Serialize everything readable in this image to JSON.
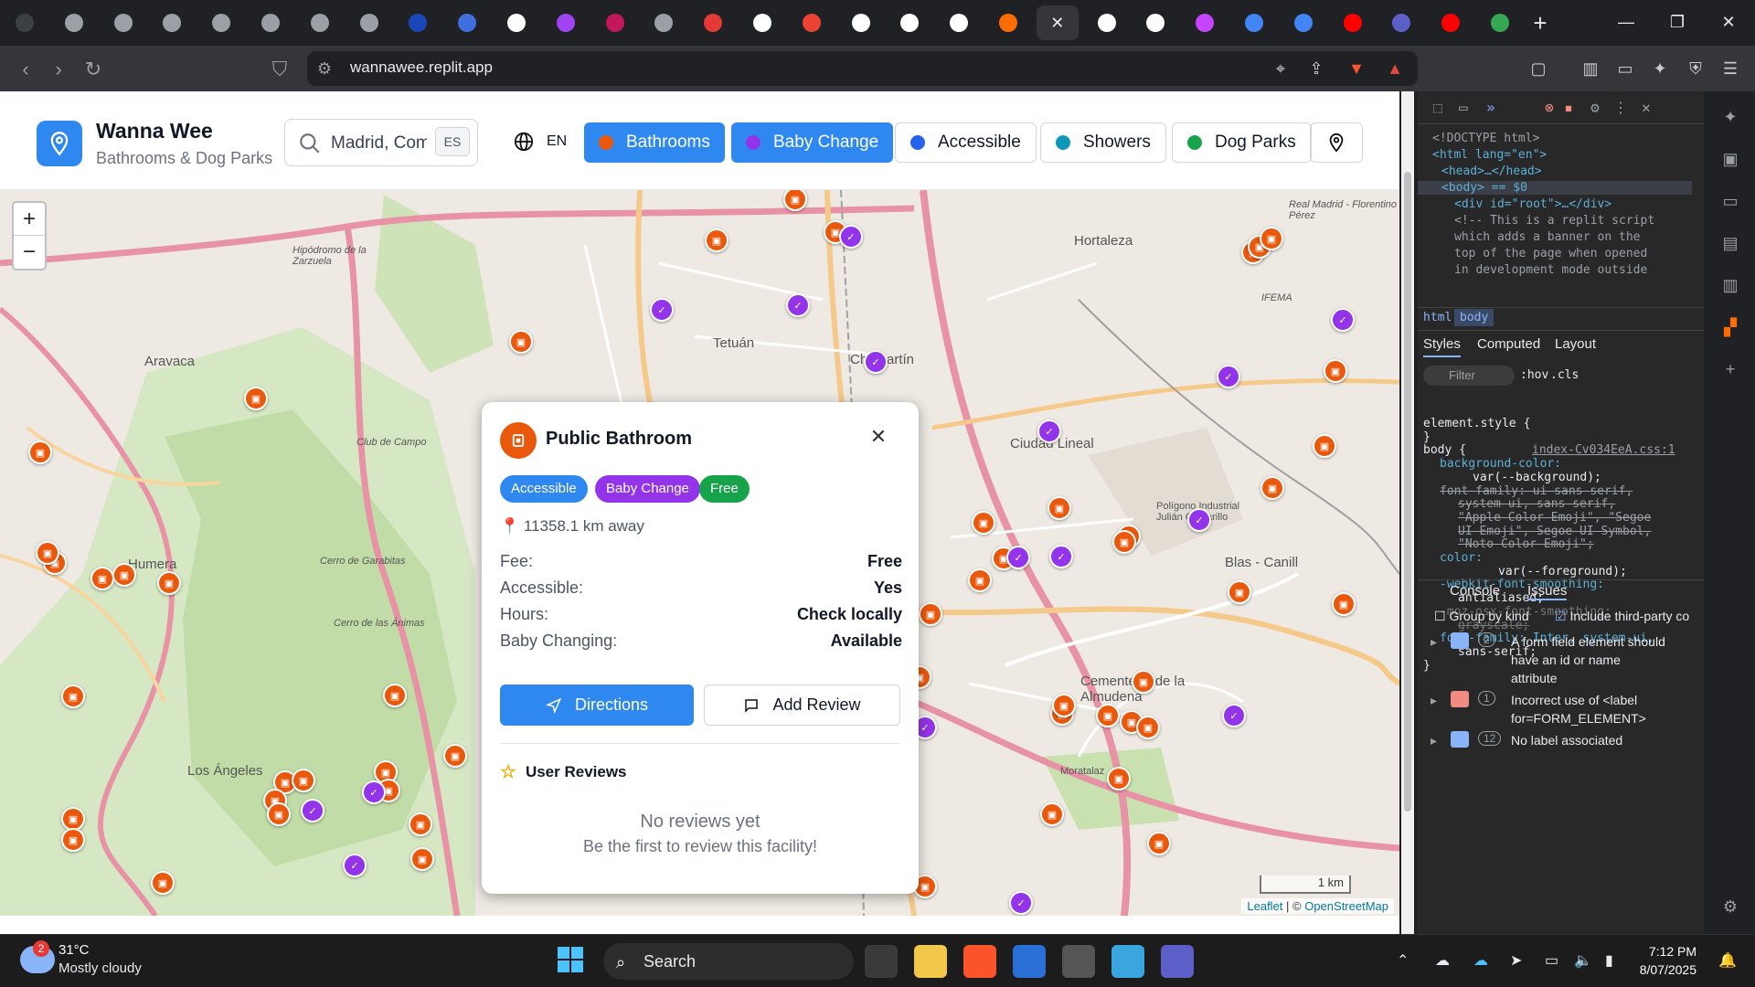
{
  "browser": {
    "url": "wannawee.replit.app",
    "tabs_colors": [
      "#3c4043",
      "#9aa0a6",
      "#9aa0a6",
      "#9aa0a6",
      "#9aa0a6",
      "#9aa0a6",
      "#9aa0a6",
      "#9aa0a6",
      "#1a47b8",
      "#3f6fdc",
      "#ffffff",
      "#a142f4",
      "#c2185b",
      "#9aa0a6",
      "#e53935",
      "#ffffff",
      "#ea4335",
      "#ffffff",
      "#ffffff",
      "#ffffff",
      "#ff6d00",
      "#ffffff",
      "#ffffff",
      "#ffffff",
      "#c544ff",
      "#4285f4",
      "#4285f4",
      "#ff0000",
      "#5b5fc7",
      "#ff0000",
      "#34a853"
    ]
  },
  "app": {
    "name": "Wanna Wee",
    "subtitle": "Bathrooms & Dog Parks",
    "search_value": "Madrid, Comunidad de Madrid",
    "lang_toggle": "ES",
    "lang_current": "EN",
    "filters": [
      {
        "label": "Bathrooms",
        "dot": "#ea580c",
        "active": true
      },
      {
        "label": "Baby Change",
        "dot": "#9333ea",
        "active": true
      },
      {
        "label": "Accessible",
        "dot": "#2563eb",
        "active": false
      },
      {
        "label": "Showers",
        "dot": "#0e98b8",
        "active": false
      },
      {
        "label": "Dog Parks",
        "dot": "#16a34a",
        "active": false
      }
    ]
  },
  "map": {
    "zoom_in": "+",
    "zoom_out": "−",
    "scale": "1 km",
    "attribution_leaflet": "Leaflet",
    "attribution_sep": " | © ",
    "attribution_osm": "OpenStreetMap",
    "labels": [
      "Tetuán",
      "Chamartín",
      "Hortaleza",
      "Ciudad Lineal",
      "Aravaca",
      "Humera",
      "Los Ángeles",
      "Blas - Canill",
      "Hipódromo de la Zarzuela",
      "Club de Campo",
      "Polígono Industrial Julián Camarillo",
      "Cementerio de la Almudena",
      "Moratalaz",
      "Real Madrid - Florentino Pérez",
      "IFEMA",
      "Cerro de Garabitas",
      "Cerro de las Ánimas"
    ]
  },
  "popup": {
    "title": "Public Bathroom",
    "badges": [
      {
        "label": "Accessible",
        "color": "#2f88f0"
      },
      {
        "label": "Baby Change",
        "color": "#9333ea"
      },
      {
        "label": "Free",
        "color": "#16a34a"
      }
    ],
    "distance": "11358.1 km away",
    "rows": [
      {
        "k": "Fee:",
        "v": "Free"
      },
      {
        "k": "Accessible:",
        "v": "Yes"
      },
      {
        "k": "Hours:",
        "v": "Check locally"
      },
      {
        "k": "Baby Changing:",
        "v": "Available"
      }
    ],
    "directions": "Directions",
    "add_review": "Add Review",
    "reviews_title": "User Reviews",
    "no_reviews": "No reviews yet",
    "no_reviews_sub": "Be the first to review this facility!"
  },
  "devtools": {
    "lines": [
      "<!DOCTYPE html>",
      "<html lang=\"en\">",
      "<head>…</head>",
      "<body> == $0",
      "<div id=\"root\">…</div>",
      "<!-- This is a replit script",
      "which adds a banner on the",
      "top of the page when opened",
      "in development mode outside"
    ],
    "breadcrumb": [
      "html",
      "body"
    ],
    "tabs": [
      "Styles",
      "Computed",
      "Layout"
    ],
    "filter_placeholder": "Filter",
    "hov": ":hov",
    "cls": ".cls",
    "css": [
      "element.style {",
      "}",
      "body {",
      "index-Cv034EeA.css:1",
      "background-color:",
      "var(--background);",
      "font-family: ui-sans-serif,",
      "system-ui, sans-serif,",
      "\"Apple Color Emoji\", \"Segoe",
      "UI Emoji\", Segoe UI Symbol,",
      "\"Noto Color Emoji\";",
      "color:",
      "var(--foreground);",
      "-webkit-font-smoothing:",
      "antialiased;",
      "-moz-osx-font-smoothing:",
      "grayscale;",
      "font-family: Inter, system-ui,",
      "sans-serif;",
      "}"
    ],
    "drawer_tabs": [
      "Console",
      "Issues"
    ],
    "group_by_kind": "Group by kind",
    "include_third_party": "Include third-party co",
    "issues": [
      {
        "count": "2",
        "text": "A form field element should have an id or name attribute"
      },
      {
        "count": "1",
        "text": "Incorrect use of <label for=FORM_ELEMENT>"
      },
      {
        "count": "12",
        "text": "No label associated"
      }
    ]
  },
  "taskbar": {
    "weather_badge": "2",
    "temp": "31°C",
    "weather": "Mostly cloudy",
    "search": "Search",
    "time": "7:12 PM",
    "date": "8/07/2025"
  }
}
